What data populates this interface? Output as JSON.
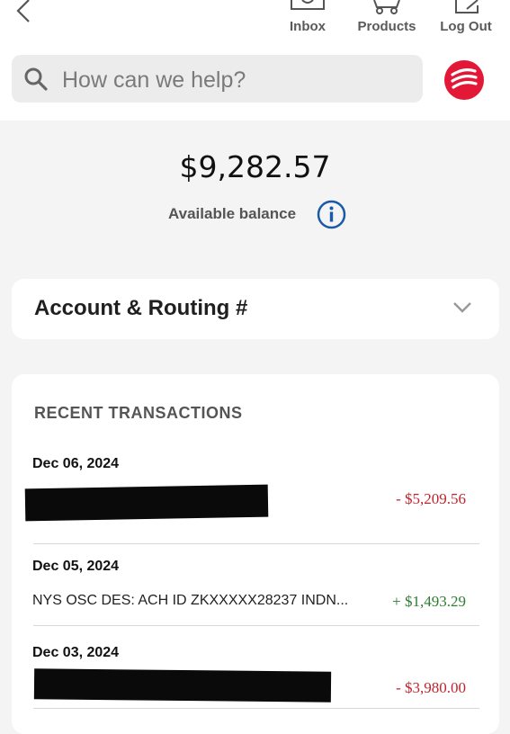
{
  "nav": {
    "inbox_label": "Inbox",
    "products_label": "Products",
    "logout_label": "Log Out"
  },
  "search": {
    "placeholder": "How can we help?"
  },
  "balance": {
    "amount": "$9,282.57",
    "label": "Available balance"
  },
  "account": {
    "title": "Account & Routing #"
  },
  "transactions": {
    "header": "RECENT TRANSACTIONS",
    "items": [
      {
        "date": "Dec 06, 2024",
        "description": "",
        "amount": "- $5,209.56"
      },
      {
        "date": "Dec 05, 2024",
        "description": "NYS OSC DES: ACH ID ZKXXXXX28237 INDN...",
        "amount": "+ $1,493.29"
      },
      {
        "date": "Dec 03, 2024",
        "description": "",
        "amount": "- $3,980.00"
      }
    ]
  },
  "colors": {
    "brand_red": "#e31837",
    "negative": "#c0242e",
    "positive": "#2e7d32",
    "info_blue": "#1a5aa8"
  }
}
